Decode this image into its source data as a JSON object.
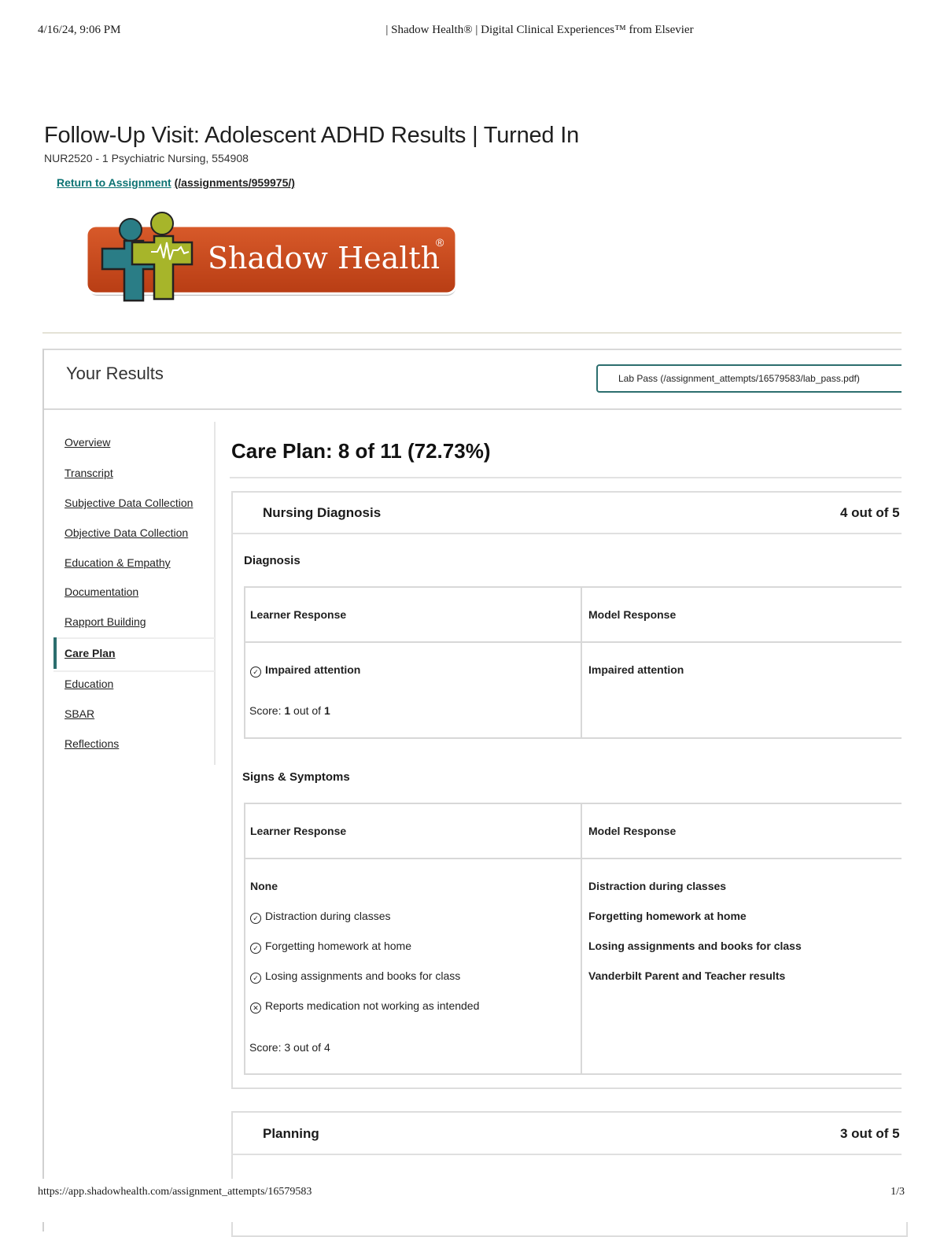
{
  "print": {
    "date": "4/16/24, 9:06 PM",
    "title": "| Shadow Health® | Digital Clinical Experiences™ from Elsevier",
    "url": "https://app.shadowhealth.com/assignment_attempts/16579583",
    "page": "1/3"
  },
  "header": {
    "title": "Follow-Up Visit: Adolescent ADHD Results | Turned In",
    "course": "NUR2520 - 1 Psychiatric Nursing, 554908",
    "return_link": "Return to Assignment",
    "return_path": "(/assignments/959975/)"
  },
  "logo": {
    "text": "Shadow Health",
    "reg": "®",
    "colors": {
      "orange": "#c94a1f",
      "lime": "#a7b52a",
      "teal": "#2a7d86"
    }
  },
  "results": {
    "title": "Your Results",
    "lab_pass": "Lab Pass (/assignment_attempts/16579583/lab_pass.pdf)"
  },
  "sidebar": {
    "items": [
      {
        "label": "Overview"
      },
      {
        "label": "Transcript"
      },
      {
        "label": "Subjective Data Collection"
      },
      {
        "label": "Objective Data Collection"
      },
      {
        "label": "Education & Empathy"
      },
      {
        "label": "Documentation"
      },
      {
        "label": "Rapport Building"
      },
      {
        "label": "Care Plan"
      },
      {
        "label": "Education"
      },
      {
        "label": "SBAR"
      },
      {
        "label": "Reflections"
      }
    ],
    "active": "Care Plan"
  },
  "care_plan": {
    "title": "Care Plan: 8 of 11 (72.73%)",
    "nursing_diagnosis": {
      "title": "Nursing Diagnosis",
      "score": "4 out of 5",
      "diagnosis": {
        "title": "Diagnosis",
        "learner_header": "Learner Response",
        "model_header": "Model Response",
        "learner": "Impaired attention",
        "model": "Impaired attention",
        "score_label": "Score:",
        "score_value": "1",
        "score_of": "out of",
        "score_total": "1"
      },
      "signs": {
        "title": "Signs & Symptoms",
        "learner_header": "Learner Response",
        "model_header": "Model Response",
        "learner_none": "None",
        "learner_items": [
          {
            "text": "Distraction during classes",
            "status": "correct"
          },
          {
            "text": "Forgetting homework at home",
            "status": "correct"
          },
          {
            "text": "Losing assignments and books for class",
            "status": "correct"
          },
          {
            "text": "Reports medication not working as intended",
            "status": "incorrect"
          }
        ],
        "model_items": [
          "Distraction during classes",
          "Forgetting homework at home",
          "Losing assignments and books for class",
          "Vanderbilt Parent and Teacher results"
        ],
        "score": "Score: 3 out of 4"
      }
    },
    "planning": {
      "title": "Planning",
      "score": "3 out of 5"
    }
  }
}
